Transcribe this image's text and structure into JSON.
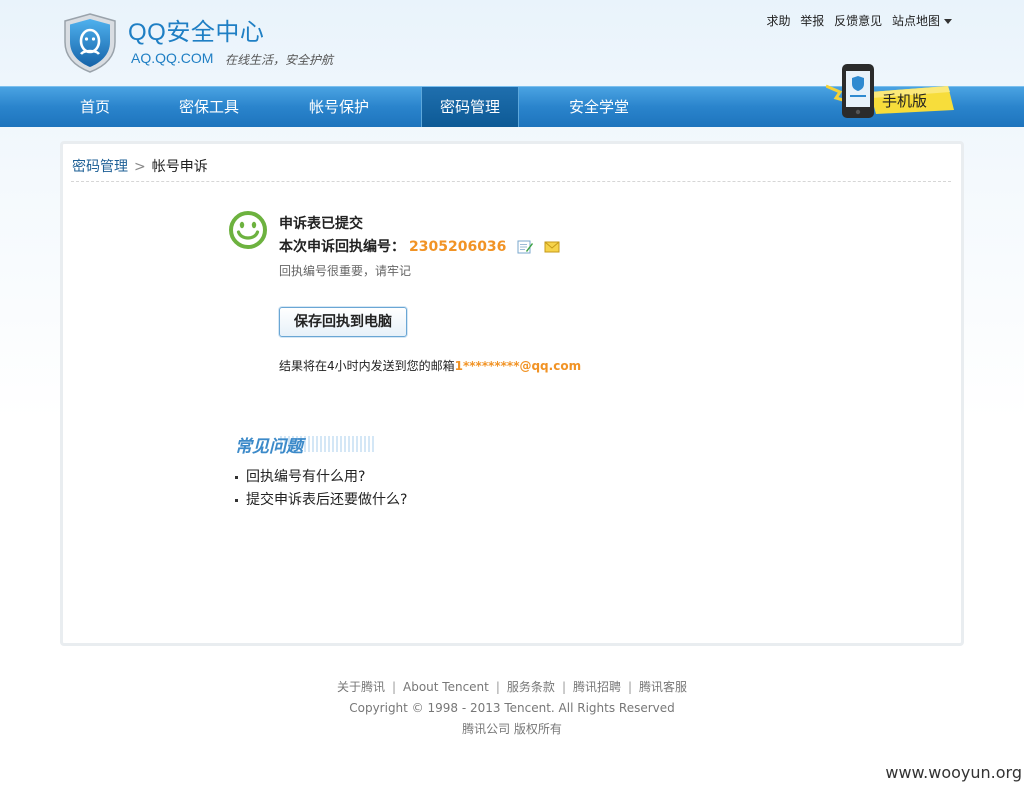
{
  "header": {
    "logo_title": "QQ安全中心",
    "logo_domain": "AQ.QQ.COM",
    "logo_slogan": "在线生活，安全护航",
    "top_links": [
      "求助",
      "举报",
      "反馈意见",
      "站点地图"
    ]
  },
  "nav": {
    "items": [
      "首页",
      "密保工具",
      "帐号保护",
      "密码管理",
      "安全学堂"
    ],
    "active": "密码管理",
    "mobile_badge": "手机版"
  },
  "breadcrumb": {
    "parent": "密码管理",
    "separator": ">",
    "current": "帐号申诉"
  },
  "result": {
    "status_title": "申诉表已提交",
    "receipt_label": "本次申诉回执编号：",
    "receipt_number": "2305206036",
    "note": "回执编号很重要，请牢记",
    "save_button": "保存回执到电脑",
    "result_text": "结果将在4小时内发送到您的邮箱",
    "email": "1*********@qq.com"
  },
  "faq": {
    "title": "常见问题",
    "items": [
      "回执编号有什么用?",
      "提交申诉表后还要做什么?"
    ]
  },
  "footer": {
    "links": [
      "关于腾讯",
      "About Tencent",
      "服务条款",
      "腾讯招聘",
      "腾讯客服"
    ],
    "copyright": "Copyright © 1998 - 2013 Tencent. All Rights Reserved",
    "company": "腾讯公司 版权所有"
  },
  "watermark": "www.wooyun.org",
  "colors": {
    "brand_blue": "#1f7fc4",
    "nav_blue": "#2a84cc",
    "accent_orange": "#f19325",
    "smiley_green": "#6db23f"
  },
  "icons": [
    "qq-shield-logo-icon",
    "smiley-icon",
    "edit-note-icon",
    "envelope-icon",
    "phone-icon"
  ]
}
